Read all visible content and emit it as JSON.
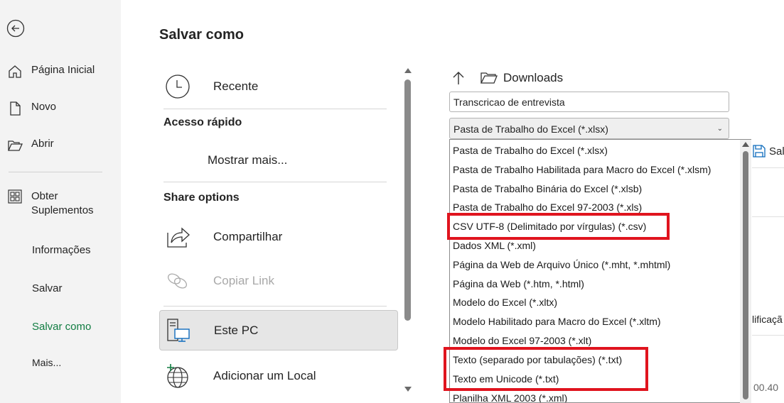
{
  "nav": {
    "back_icon": "back-arrow-icon",
    "items": [
      {
        "label": "Página Inicial",
        "icon": "home-icon"
      },
      {
        "label": "Novo",
        "icon": "new-document-icon"
      },
      {
        "label": "Abrir",
        "icon": "folder-open-icon"
      },
      {
        "label": "Obter",
        "label2": "Suplementos",
        "icon": "addins-grid-icon"
      },
      {
        "label": "Informações"
      },
      {
        "label": "Salvar"
      },
      {
        "label": "Salvar como",
        "active": true
      },
      {
        "label": "Mais..."
      }
    ]
  },
  "page": {
    "title": "Salvar como"
  },
  "locations": {
    "recent": "Recente",
    "quick_access_header": "Acesso rápido",
    "show_more": "Mostrar mais...",
    "share_header": "Share options",
    "share": "Compartilhar",
    "copy_link": "Copiar Link",
    "this_pc": "Este PC",
    "add_location": "Adicionar um Local"
  },
  "save_panel": {
    "folder": "Downloads",
    "filename_value": "Transcricao de entrevista",
    "filetype_selected": "Pasta de Trabalho do Excel (*.xlsx)",
    "save_partial": "Sal",
    "partial_text_1": "lificaçã",
    "partial_text_2": "00.40"
  },
  "filetype_options": [
    "Pasta de Trabalho do Excel (*.xlsx)",
    "Pasta de Trabalho Habilitada para Macro do Excel (*.xlsm)",
    "Pasta de Trabalho Binária do Excel (*.xlsb)",
    "Pasta de Trabalho do Excel 97-2003 (*.xls)",
    "CSV UTF-8 (Delimitado por vírgulas) (*.csv)",
    "Dados XML (*.xml)",
    "Página da Web de Arquivo Único (*.mht, *.mhtml)",
    "Página da Web (*.htm, *.html)",
    "Modelo do Excel (*.xltx)",
    "Modelo Habilitado para Macro do Excel (*.xltm)",
    "Modelo do Excel 97-2003 (*.xlt)",
    "Texto (separado por tabulações) (*.txt)",
    "Texto em Unicode (*.txt)",
    "Planilha XML 2003 (*.xml)"
  ],
  "colors": {
    "accent": "#107c41",
    "highlight": "#e0141e"
  }
}
